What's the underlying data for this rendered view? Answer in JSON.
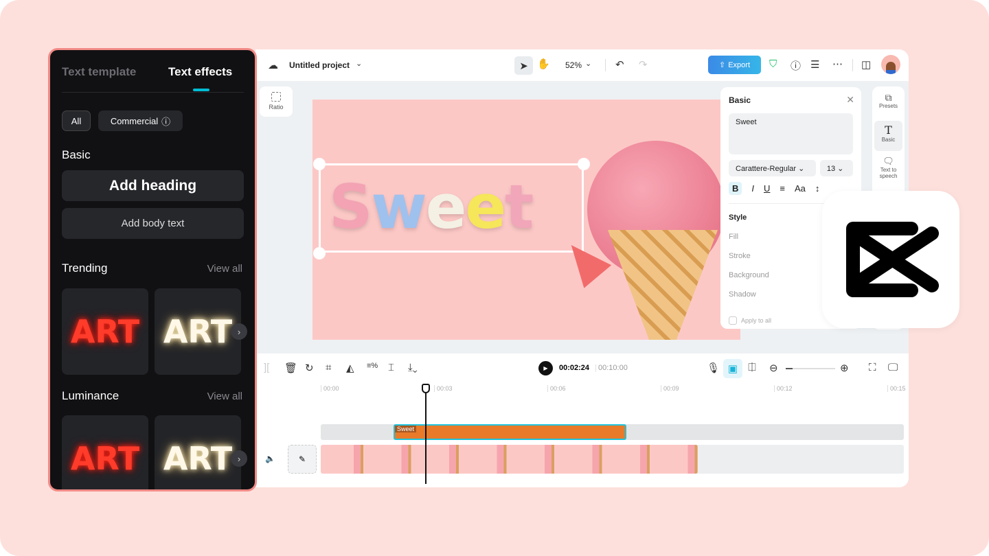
{
  "topbar": {
    "project_title": "Untitled project",
    "zoom": "52%",
    "export_label": "Export"
  },
  "canvas": {
    "ratio_label": "Ratio",
    "text_letters": [
      "S",
      "w",
      "e",
      "e",
      "t"
    ],
    "letter_colors": [
      "#f3a3b4",
      "#9fc1ee",
      "#f4f0e4",
      "#f5e65a",
      "#f1a6b9"
    ]
  },
  "basic_panel": {
    "title": "Basic",
    "text_value": "Sweet",
    "font": "Carattere-Regular",
    "size": "13",
    "style_label": "Style",
    "style_items": [
      "Fill",
      "Stroke",
      "Background",
      "Shadow"
    ],
    "apply_all": "Apply to all"
  },
  "right_sidebar": {
    "items": [
      "Presets",
      "Basic",
      "Text to speech"
    ]
  },
  "timeline": {
    "current_time": "00:02:24",
    "total_time": "00:10:00",
    "ruler": [
      "00:00",
      "00:03",
      "00:06",
      "00:09",
      "00:12",
      "00:15"
    ],
    "text_clip": "Sweet"
  },
  "left_panel": {
    "tabs": [
      "Text template",
      "Text effects"
    ],
    "active_tab": "Text effects",
    "filters": [
      "All",
      "Commercial"
    ],
    "basic_heading": "Basic",
    "add_heading": "Add heading",
    "add_body": "Add body text",
    "trending": "Trending",
    "luminance": "Luminance",
    "view_all": "View all",
    "card_text": "ART"
  },
  "colors": {
    "accent": "#00bcd4",
    "export": "#3b8ae6",
    "panel_border": "#f18a86",
    "clip": "#e87a2a"
  }
}
